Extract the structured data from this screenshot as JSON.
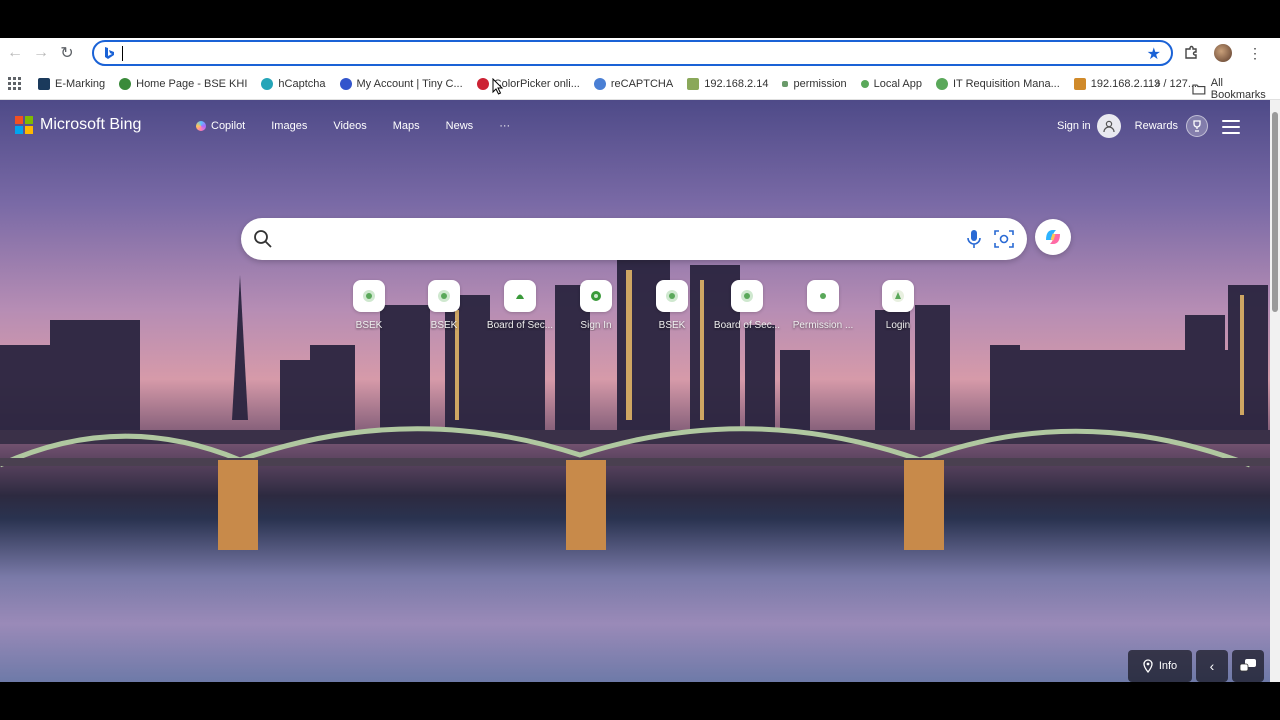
{
  "browser": {
    "address_value": "",
    "bookmarks": [
      {
        "label": "E-Marking",
        "color": "#1b3a5c"
      },
      {
        "label": "Home Page - BSE KHI",
        "color": "#3a8a3a"
      },
      {
        "label": "hCaptcha",
        "color": "#25a5b8"
      },
      {
        "label": "My Account | Tiny C...",
        "color": "#3355cc"
      },
      {
        "label": "ColorPicker onli...",
        "color": "#cc2233"
      },
      {
        "label": "reCAPTCHA",
        "color": "#4a7fd4"
      },
      {
        "label": "192.168.2.14",
        "color": "#8aa85a"
      },
      {
        "label": "permission",
        "color": "#6a9a6a"
      },
      {
        "label": "Local App",
        "color": "#5aa85a"
      },
      {
        "label": "IT Requisition Mana...",
        "color": "#5aa85a"
      },
      {
        "label": "192.168.2.113 / 127....",
        "color": "#d08a2a"
      }
    ],
    "more_bookmarks": "»",
    "all_bookmarks": "All Bookmarks"
  },
  "bing": {
    "logo_text": "Microsoft Bing",
    "nav": [
      "Copilot",
      "Images",
      "Videos",
      "Maps",
      "News",
      "···"
    ],
    "sign_in": "Sign in",
    "rewards": "Rewards",
    "search_placeholder": "",
    "quick_links": [
      "BSEK",
      "BSEK",
      "Board of Sec...",
      "Sign In",
      "BSEK",
      "Board of Sec...",
      "Permission ...",
      "Login"
    ],
    "info_label": "Info"
  },
  "icons": {
    "back": "arrow-left-icon",
    "forward": "arrow-right-icon",
    "reload": "reload-icon",
    "star": "star-icon",
    "extensions": "puzzle-icon",
    "menu": "kebab-icon",
    "search": "search-icon",
    "mic": "microphone-icon",
    "visual": "camera-search-icon"
  }
}
